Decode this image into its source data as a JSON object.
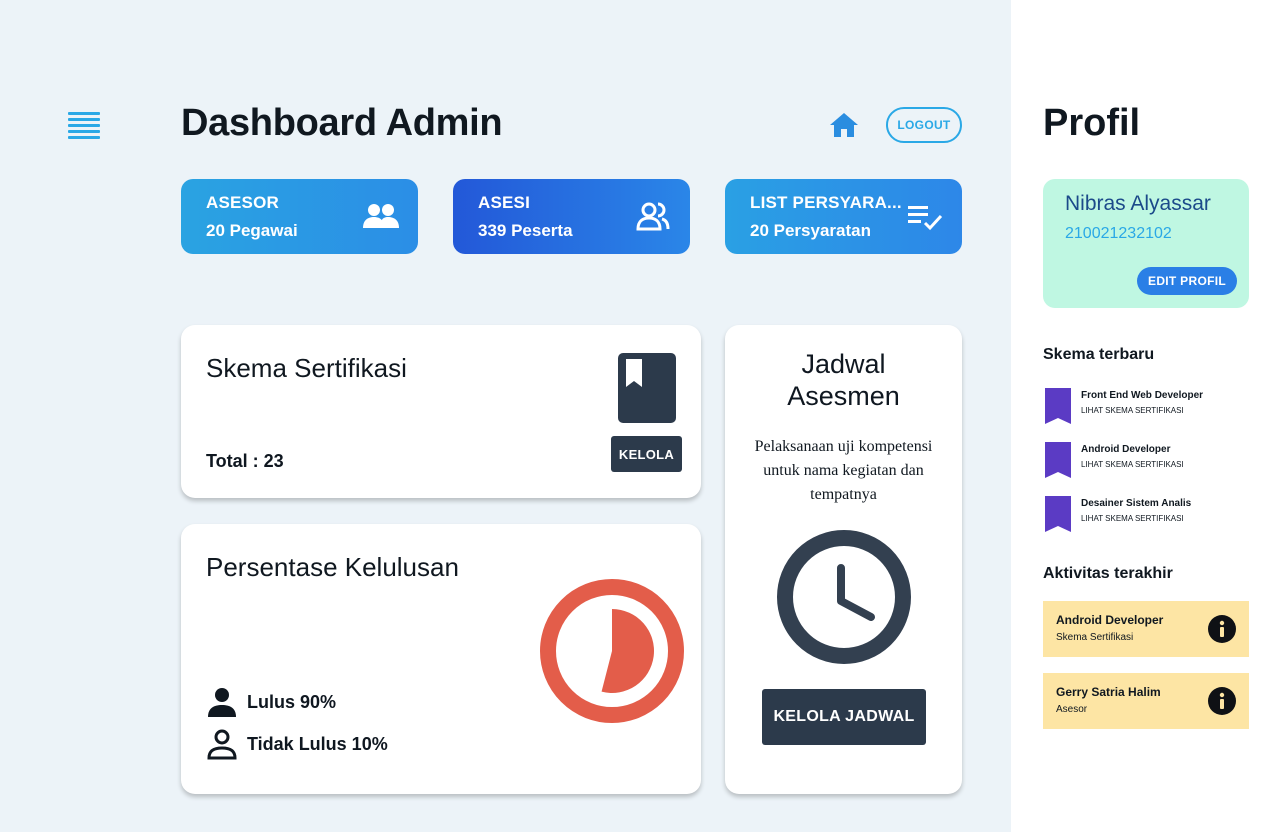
{
  "header": {
    "title": "Dashboard Admin",
    "home_icon": "home-icon",
    "logout_label": "LOGOUT",
    "menu_icon": "hamburger-menu-icon"
  },
  "stats": [
    {
      "label": "ASESOR",
      "value": "20 Pegawai",
      "icon": "users-group-icon"
    },
    {
      "label": "ASESI",
      "value": "339 Peserta",
      "icon": "users-group-icon"
    },
    {
      "label": "LIST PERSYARA...",
      "value": "20 Persyaratan",
      "icon": "checklist-icon"
    }
  ],
  "skema": {
    "title": "Skema Sertifikasi",
    "total": "Total : 23",
    "button": "KELOLA",
    "icon": "book-icon"
  },
  "kelulusan": {
    "title": "Persentase Kelulusan",
    "lulus": "Lulus 90%",
    "tidak_lulus": "Tidak Lulus 10%"
  },
  "chart_data": {
    "type": "pie",
    "categories": [
      "Lulus",
      "Tidak Lulus"
    ],
    "values": [
      90,
      10
    ],
    "title": "",
    "colors": [
      "#e35d4a",
      "#ffffff"
    ]
  },
  "jadwal": {
    "title_line1": "Jadwal",
    "title_line2": "Asesmen",
    "description": "Pelaksanaan uji kompetensi untuk nama kegiatan dan tempatnya",
    "button": "KELOLA JADWAL",
    "icon": "clock-icon"
  },
  "profil": {
    "heading": "Profil",
    "name": "Nibras Alyassar",
    "id_number": "210021232102",
    "edit_button": "EDIT PROFIL"
  },
  "skema_terbaru": {
    "heading": "Skema terbaru",
    "items": [
      {
        "name": "Front End Web Developer",
        "link": "LIHAT SKEMA SERTIFIKASI"
      },
      {
        "name": "Android Developer",
        "link": "LIHAT SKEMA SERTIFIKASI"
      },
      {
        "name": "Desainer Sistem Analis",
        "link": "LIHAT SKEMA SERTIFIKASI"
      }
    ]
  },
  "aktivitas": {
    "heading": "Aktivitas terakhir",
    "items": [
      {
        "title": "Android Developer",
        "subtitle": "Skema Sertifikasi"
      },
      {
        "title": "Gerry Satria Halim",
        "subtitle": "Asesor"
      }
    ]
  },
  "colors": {
    "accent": "#2aa8e6",
    "dark_button": "#2c3a4b",
    "pie": "#e35d4a",
    "bookmark": "#5b3bc4",
    "profile_card": "#bff7e2",
    "activity_card": "#fde5a4"
  }
}
